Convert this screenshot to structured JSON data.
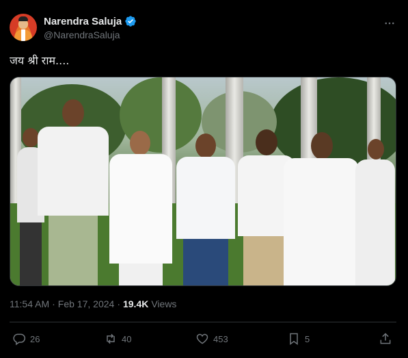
{
  "author": {
    "display_name": "Narendra Saluja",
    "handle": "@NarendraSaluja",
    "verified_icon": "verified-badge-icon",
    "avatar_icon": "avatar"
  },
  "more_icon": "more-options-icon",
  "tweet": {
    "text": "जय श्री राम....",
    "time": "11:54 AM",
    "separator": "·",
    "date": "Feb 17, 2024",
    "views_count": "19.4K",
    "views_label": "Views"
  },
  "actions": {
    "replies": "26",
    "reposts": "40",
    "likes": "453",
    "bookmarks": "5"
  },
  "colors": {
    "background": "#000000",
    "text": "#e7e9ea",
    "secondary_text": "#71767b",
    "verified": "#1d9bf0",
    "divider": "#2f3336"
  }
}
